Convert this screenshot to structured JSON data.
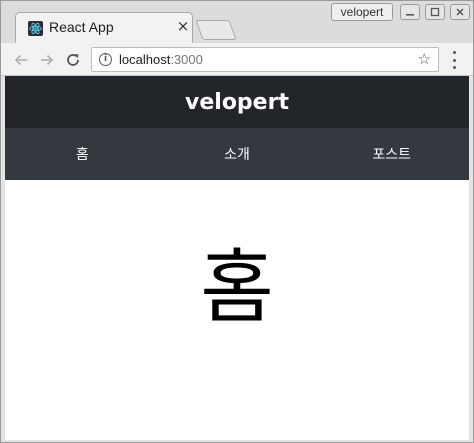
{
  "browser": {
    "tab": {
      "title": "React App",
      "close_glyph": "×"
    },
    "profile_name": "velopert",
    "url": {
      "host": "localhost",
      "port": ":3000"
    },
    "icons": {
      "favicon": "react-icon",
      "close": "close-icon",
      "back": "back-arrow-icon",
      "forward": "forward-arrow-icon",
      "reload": "reload-icon",
      "info": "info-icon",
      "bookmark": "star-icon",
      "menu": "kebab-menu-icon"
    },
    "info_glyph": "i",
    "star_glyph": "☆"
  },
  "app": {
    "header_title": "velopert",
    "menu": [
      {
        "label": "홈"
      },
      {
        "label": "소개"
      },
      {
        "label": "포스트"
      }
    ],
    "page_heading": "홈",
    "colors": {
      "header_bg": "#22262a",
      "menu_bg": "#33393f",
      "text_light": "#ffffff"
    }
  }
}
